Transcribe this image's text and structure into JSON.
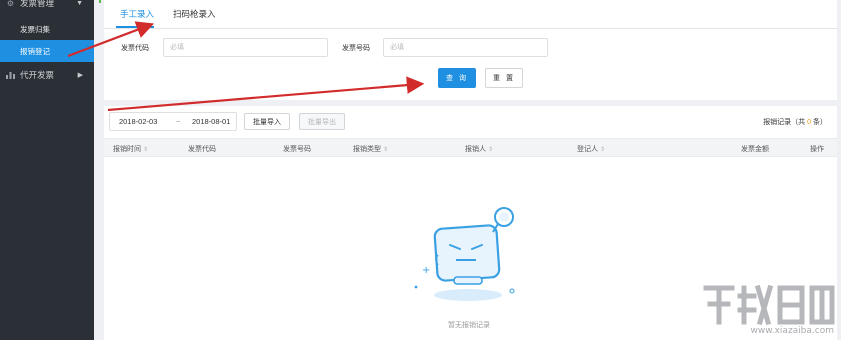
{
  "sidebar": {
    "groups": [
      {
        "label": "发票管理",
        "icon": "gear-icon",
        "caret": "▼"
      },
      {
        "label": "代开发票",
        "icon": "bar-chart-icon",
        "caret": "▶"
      }
    ],
    "items": [
      {
        "label": "发票归集",
        "active": false
      },
      {
        "label": "报销登记",
        "active": true
      }
    ]
  },
  "tabs": [
    {
      "label": "手工录入",
      "active": true
    },
    {
      "label": "扫码枪录入",
      "active": false
    }
  ],
  "form": {
    "invoice_code_label": "发票代码",
    "invoice_code_placeholder": "必填",
    "invoice_number_label": "发票号码",
    "invoice_number_placeholder": "必填",
    "query_button": "查 询",
    "reset_button": "重 置"
  },
  "toolbar": {
    "date_start": "2018-02-03",
    "date_sep": "~",
    "date_end": "2018-08-01",
    "batch_import": "批量导入",
    "batch_export": "批量导出",
    "records_prefix": "报销记录（共",
    "records_count": "0",
    "records_suffix": "条）"
  },
  "table": {
    "columns": [
      "报销时间",
      "发票代码",
      "发票号码",
      "报销类型",
      "报销人",
      "登记人",
      "发票金额",
      "操作"
    ],
    "empty_text": "暂无报销记录"
  },
  "watermark": {
    "text": "www.xiazaiba.com"
  },
  "colors": {
    "accent": "#1e8fe1",
    "sidebar_bg": "#2b3036",
    "annotation_arrow": "#d22b2b",
    "count_highlight": "#f39c12"
  }
}
